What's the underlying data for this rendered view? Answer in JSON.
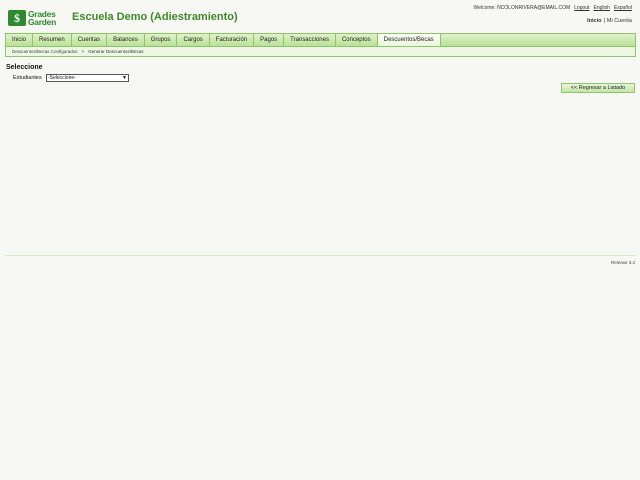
{
  "header": {
    "logo_mark": "$",
    "logo_line1": "Grades",
    "logo_line2": "Garden",
    "app_title": "Escuela Demo (Adiestramiento)",
    "welcome": "Welcome: NCOLONRIVERA@EMAIL.COM",
    "logout": "Logout",
    "english": "English",
    "espanol": "Español",
    "home": "Inicio",
    "separator": "|",
    "my_account": "Mi Cuenta"
  },
  "nav": {
    "items": [
      {
        "label": "Inicio"
      },
      {
        "label": "Resumen"
      },
      {
        "label": "Cuentas"
      },
      {
        "label": "Balances"
      },
      {
        "label": "Grupos"
      },
      {
        "label": "Cargos"
      },
      {
        "label": "Facturación"
      },
      {
        "label": "Pagos"
      },
      {
        "label": "Transacciones"
      },
      {
        "label": "Conceptos"
      },
      {
        "label": "Descuentos/Becas"
      }
    ],
    "selected_index": 10
  },
  "breadcrumb": {
    "link": "Descuentos/Becas Configurados",
    "separator": ">",
    "current": "Generar Descuentos/Becas"
  },
  "main": {
    "section_title": "Seleccione",
    "students_label": "Estudiantes",
    "students_select_value": "-Seleccione-",
    "back_button": "<< Regresar a Listado"
  },
  "footer": {
    "release": "Release 3.3"
  },
  "colors": {
    "brand_green": "#3d8a2a",
    "nav_gradient_top": "#dff2c9",
    "nav_gradient_bottom": "#b9e197",
    "nav_border": "#8cc56a",
    "background": "#f7f7f3"
  }
}
